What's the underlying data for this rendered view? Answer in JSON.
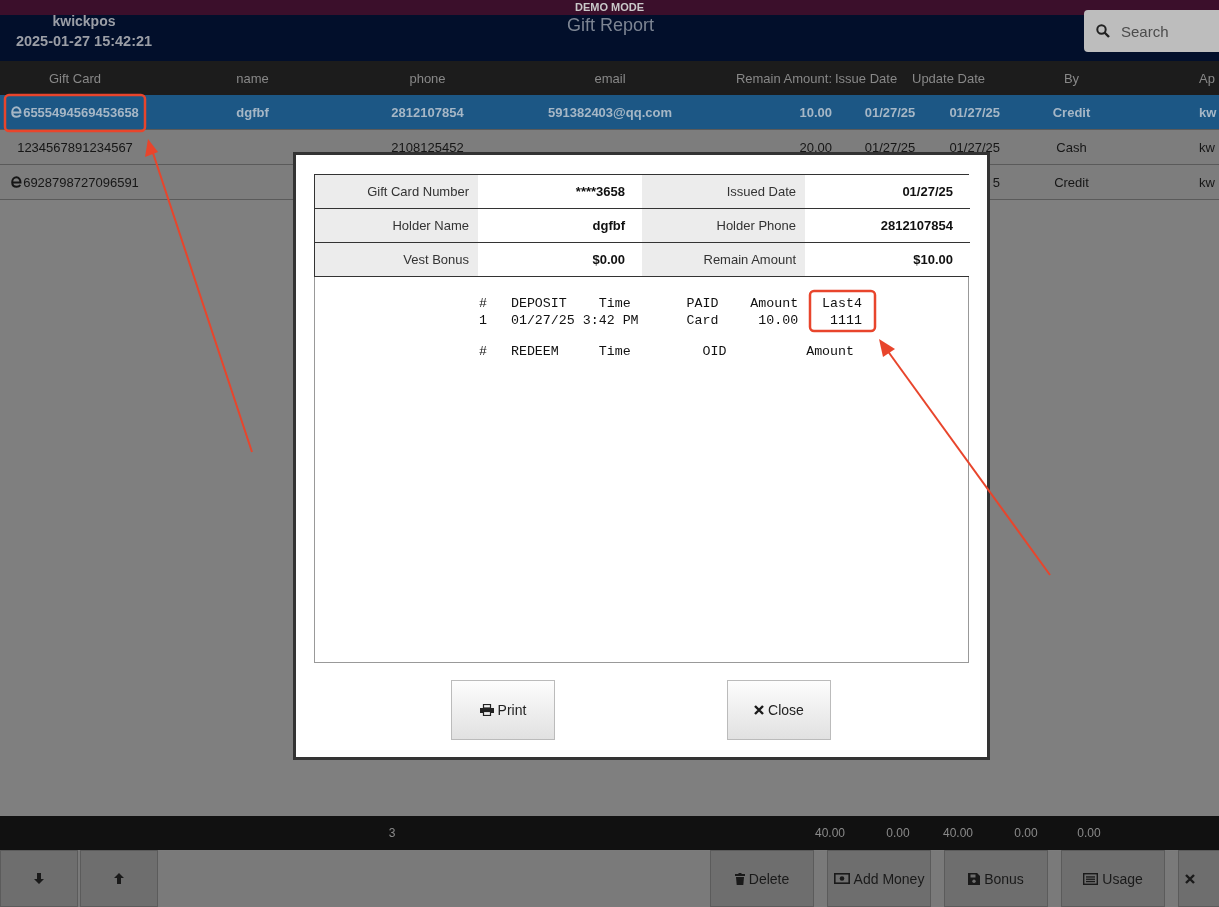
{
  "header": {
    "banner": "DEMO MODE",
    "store": "kwickpos",
    "datetime": "2025-01-27 15:42:21",
    "title": "Gift Report",
    "search": {
      "placeholder": "Search"
    }
  },
  "table": {
    "columns": [
      "Gift Card",
      "name",
      "phone",
      "email",
      "Remain Amount:",
      "Issue Date",
      "Update Date",
      "By",
      "Ap"
    ],
    "rows": [
      {
        "selected": true,
        "card_icon": true,
        "cells": [
          "6555494569453658",
          "dgfbf",
          "2812107854",
          "591382403@qq.com",
          "10.00",
          "01/27/25",
          "01/27/25",
          "Credit",
          "kw"
        ]
      },
      {
        "selected": false,
        "card_icon": false,
        "cells": [
          "1234567891234567",
          null,
          "2108125452",
          null,
          "20.00",
          "01/27/25",
          "01/27/25",
          "Cash",
          "kw"
        ]
      },
      {
        "selected": false,
        "card_icon": true,
        "cells": [
          "6928798727096591",
          null,
          null,
          null,
          null,
          null,
          "5",
          "Credit",
          "kw"
        ]
      }
    ]
  },
  "totals": {
    "count": "3",
    "values": [
      "40.00",
      "0.00",
      "40.00",
      "0.00",
      "0.00"
    ]
  },
  "toolbar": [
    {
      "kind": "down"
    },
    {
      "kind": "up"
    },
    {
      "kind": "delete",
      "label": "Delete"
    },
    {
      "kind": "add_money",
      "label": "Add Money"
    },
    {
      "kind": "bonus",
      "label": "Bonus"
    },
    {
      "kind": "usage",
      "label": "Usage"
    },
    {
      "kind": "cancel"
    }
  ],
  "dialog": {
    "fields": [
      {
        "label": "Gift Card Number",
        "value": "****3658"
      },
      {
        "label": "Issued Date",
        "value": "01/27/25"
      },
      {
        "label": "Holder Name",
        "value": "dgfbf"
      },
      {
        "label": "Holder Phone",
        "value": "2812107854"
      },
      {
        "label": "Vest Bonus",
        "value": "$0.00"
      },
      {
        "label": "Remain Amount",
        "value": "$10.00"
      }
    ],
    "report_sections": [
      [
        "#   DEPOSIT    Time       PAID    Amount   Last4",
        "1   01/27/25 3:42 PM      Card     10.00    1111"
      ],
      [
        "#   REDEEM     Time         OID          Amount"
      ]
    ],
    "buttons": [
      {
        "kind": "print",
        "label": "Print"
      },
      {
        "kind": "close",
        "label": "Close"
      }
    ]
  }
}
